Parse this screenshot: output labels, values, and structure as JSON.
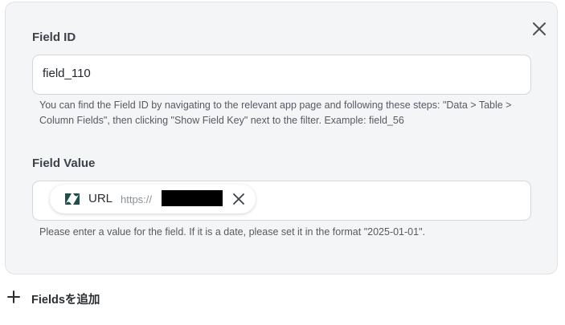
{
  "field_id": {
    "label": "Field ID",
    "value": "field_110",
    "help": "You can find the Field ID by navigating to the relevant app page and following these steps: \"Data > Table > Column Fields\", then clicking \"Show Field Key\" next to the filter. Example: field_56"
  },
  "field_value": {
    "label": "Field Value",
    "chip": {
      "icon": "zendesk-logo-icon",
      "label": "URL",
      "url_prefix": "https://"
    },
    "help": "Please enter a value for the field. If it is a date, please set it in the format \"2025-01-01\"."
  },
  "add_fields": {
    "label": "Fieldsを追加"
  },
  "colors": {
    "panel_bg": "#f4f5f7",
    "border": "#d3d7dc",
    "text": "#2b2f33",
    "muted": "#555b61"
  }
}
